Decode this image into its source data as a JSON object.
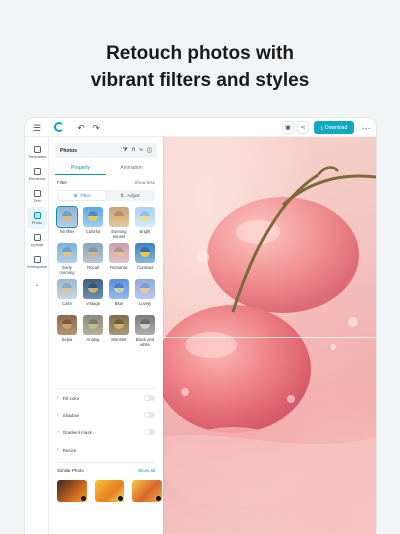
{
  "headline": {
    "line1": "Retouch photos with",
    "line2": "vibrant filters and styles"
  },
  "topbar": {
    "download_label": "Download"
  },
  "rail": {
    "items": [
      {
        "label": "Templates",
        "icon": "templates-icon"
      },
      {
        "label": "Elements",
        "icon": "elements-icon"
      },
      {
        "label": "Text",
        "icon": "text-icon"
      },
      {
        "label": "Photo",
        "icon": "photo-icon",
        "active": true
      },
      {
        "label": "Upload",
        "icon": "upload-icon"
      },
      {
        "label": "Workspace",
        "icon": "workspace-icon"
      }
    ]
  },
  "panel": {
    "title": "Photos",
    "tabs": [
      "Property",
      "Animation"
    ],
    "filter_label": "Filter",
    "show_less": "Show less",
    "segments": [
      "Filter",
      "Adjust"
    ],
    "filters": [
      "No filter",
      "Colorful",
      "Evening sunset",
      "Bright",
      "Early morning",
      "Recall",
      "Romantic",
      "Contrast",
      "Calm",
      "Vintage",
      "Blue",
      "Lovely",
      "Sepia",
      "Analog",
      "Monster",
      "Black and white"
    ],
    "options": [
      "Fill color",
      "Shadow",
      "Gradient mask",
      "Resize"
    ],
    "similar_title": "Similar Photo",
    "show_all": "Show all"
  },
  "colors": {
    "accent": "#12a8c0",
    "canvas_pink": "#f3c3bf"
  }
}
